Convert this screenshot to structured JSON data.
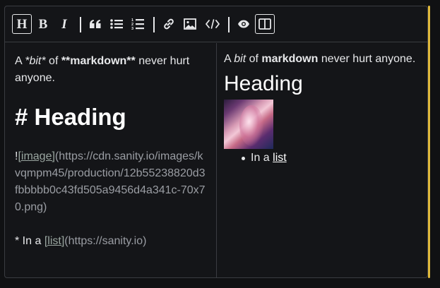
{
  "toolbar": {
    "heading_label": "H",
    "bold_label": "B",
    "italic_label": "I"
  },
  "source": {
    "line1_a": "A ",
    "line1_italic": "*bit*",
    "line1_b": " of ",
    "line1_bold": "**markdown**",
    "line1_c": " never hurt anyone.",
    "heading": "# Heading",
    "image_bang": "!",
    "image_alt": "[image]",
    "image_url": "(https://cdn.sanity.io/images/kvqmpm45/production/12b55238820d3fbbbbb0c43fd505a9456d4a341c-70x70.png)",
    "list_prefix": "* In a ",
    "list_link": "[list]",
    "list_url": "(https://sanity.io)"
  },
  "preview": {
    "p_a": "A ",
    "p_italic": "bit",
    "p_b": " of ",
    "p_bold": "markdown",
    "p_c": " never hurt anyone.",
    "heading": "Heading",
    "list_prefix": "In a ",
    "list_link": "list"
  },
  "colors": {
    "background": "#101113",
    "border": "#3a3c41",
    "accent": "#e0b93b",
    "text": "#e7e8ea",
    "link": "#9aa6a0"
  }
}
